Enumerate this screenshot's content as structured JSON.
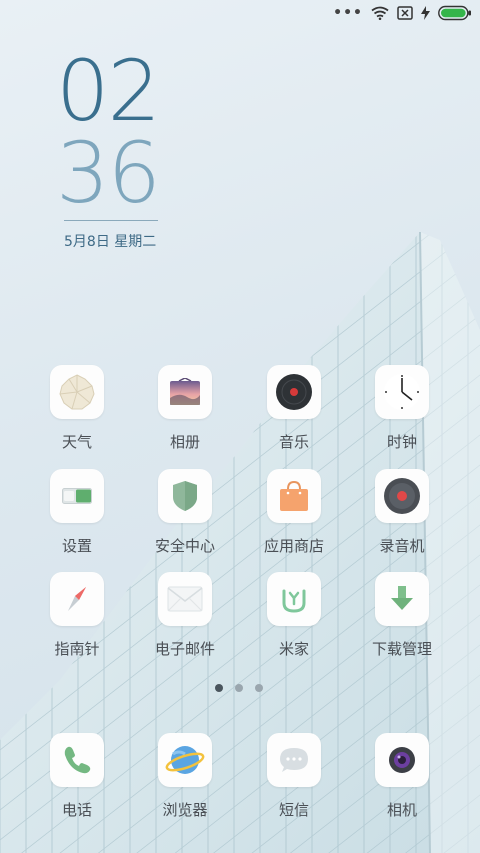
{
  "clock": {
    "hours": "02",
    "minutes": "36",
    "date": "5月8日 星期二"
  },
  "pager": {
    "pages": 3,
    "current": 1
  },
  "apps": [
    {
      "label": "天气",
      "icon": "weather-icon"
    },
    {
      "label": "相册",
      "icon": "gallery-icon"
    },
    {
      "label": "音乐",
      "icon": "music-icon"
    },
    {
      "label": "时钟",
      "icon": "clock-icon"
    },
    {
      "label": "设置",
      "icon": "settings-icon"
    },
    {
      "label": "安全中心",
      "icon": "security-icon"
    },
    {
      "label": "应用商店",
      "icon": "app-store-icon"
    },
    {
      "label": "录音机",
      "icon": "recorder-icon"
    },
    {
      "label": "指南针",
      "icon": "compass-icon"
    },
    {
      "label": "电子邮件",
      "icon": "email-icon"
    },
    {
      "label": "米家",
      "icon": "mijia-icon"
    },
    {
      "label": "下载管理",
      "icon": "download-icon"
    }
  ],
  "dock": [
    {
      "label": "电话",
      "icon": "phone-icon"
    },
    {
      "label": "浏览器",
      "icon": "browser-icon"
    },
    {
      "label": "短信",
      "icon": "messages-icon"
    },
    {
      "label": "相机",
      "icon": "camera-icon"
    }
  ],
  "colors": {
    "battery": "#35b54a",
    "clock_hours": "#3a6f8e",
    "clock_minutes": "#7ea6bd"
  }
}
